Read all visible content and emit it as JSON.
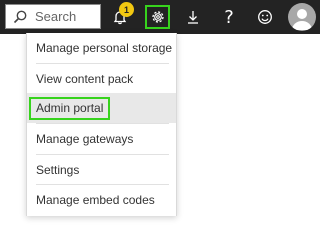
{
  "header": {
    "search": {
      "placeholder": "Search"
    },
    "notifications": {
      "badge_count": "1"
    },
    "actions": [
      "search-icon",
      "bell-icon",
      "gear-icon",
      "download-icon",
      "help-icon",
      "smiley-icon",
      "avatar"
    ]
  },
  "settings_menu": {
    "items": [
      {
        "label": "Manage personal storage"
      },
      {
        "label": "View content pack"
      },
      {
        "label": "Admin portal",
        "highlighted": true
      },
      {
        "label": "Manage gateways"
      },
      {
        "label": "Settings"
      },
      {
        "label": "Manage embed codes"
      }
    ]
  },
  "colors": {
    "topbar": "#232323",
    "badge": "#f2c811",
    "highlight_outline": "#37d31d",
    "hover_row": "#e8e8e8"
  }
}
